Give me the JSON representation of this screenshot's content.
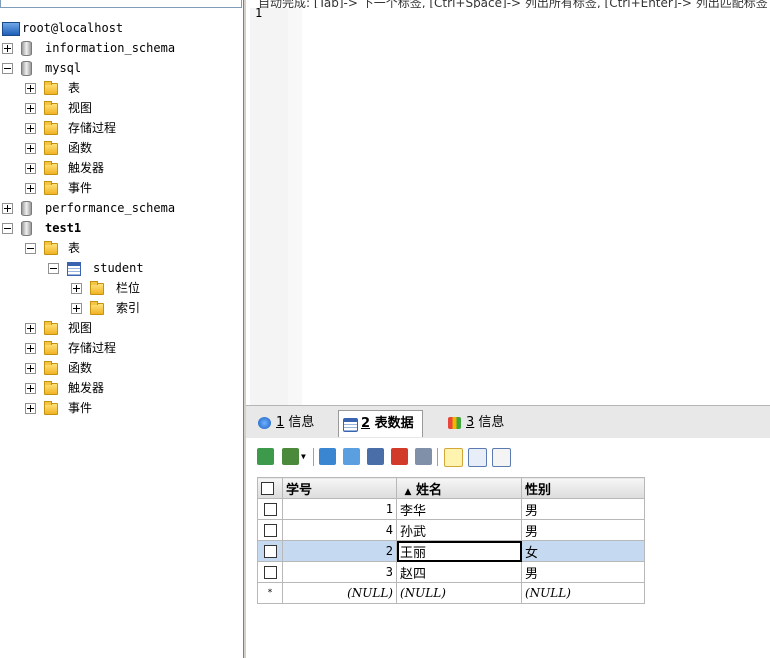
{
  "editor": {
    "hint": "自动完成: [Tab]-> 下一个标签, [Ctrl+Space]-> 列出所有标签, [Ctrl+Enter]-> 列出匹配标签",
    "line_number": "1"
  },
  "tree": {
    "connection": "root@localhost",
    "databases": [
      {
        "name": "information_schema"
      },
      {
        "name": "mysql",
        "children": [
          "表",
          "视图",
          "存储过程",
          "函数",
          "触发器",
          "事件"
        ]
      },
      {
        "name": "performance_schema"
      },
      {
        "name": "test1"
      }
    ],
    "test1": {
      "tables_label": "表",
      "table": "student",
      "table_children": [
        "栏位",
        "索引"
      ],
      "others": [
        "视图",
        "存储过程",
        "函数",
        "触发器",
        "事件"
      ]
    }
  },
  "results": {
    "tabs": [
      {
        "num": "1",
        "label": "信息"
      },
      {
        "num": "2",
        "label": "表数据"
      },
      {
        "num": "3",
        "label": "信息"
      }
    ],
    "columns": [
      "学号",
      "姓名",
      "性别"
    ],
    "sort_indicator": "▲",
    "rows": [
      {
        "id": "1",
        "name": "李华",
        "gender": "男"
      },
      {
        "id": "4",
        "name": "孙武",
        "gender": "男"
      },
      {
        "id": "2",
        "name": "王丽",
        "gender": "女"
      },
      {
        "id": "3",
        "name": "赵四",
        "gender": "男"
      }
    ],
    "new_row": {
      "marker": "*",
      "id": "(NULL)",
      "name": "(NULL)",
      "gender": "(NULL)"
    }
  }
}
